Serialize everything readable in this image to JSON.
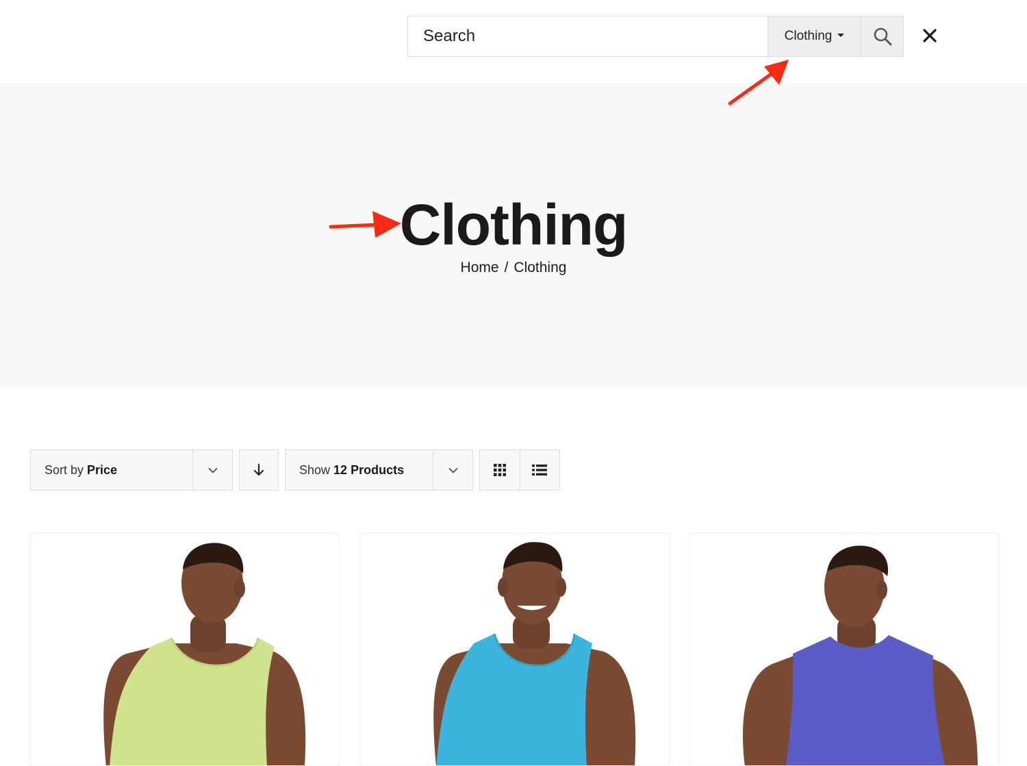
{
  "search": {
    "placeholder": "Search",
    "category": "Clothing"
  },
  "hero": {
    "title": "Clothing",
    "breadcrumb": [
      "Home",
      "/",
      "Clothing"
    ]
  },
  "toolbar": {
    "sort_prefix": "Sort by",
    "sort_value": "Price",
    "show_prefix": "Show",
    "show_value": "12 Products"
  },
  "icons": {
    "search": "search-icon",
    "close": "close-icon",
    "chevron": "chevron-down-icon",
    "sort_direction": "arrow-down-icon",
    "grid_view": "grid-icon",
    "list_view": "list-icon"
  },
  "products": [
    {
      "shirt_color": "#cfe38c",
      "style": "tank-top"
    },
    {
      "shirt_color": "#3db4dd",
      "style": "tank-top"
    },
    {
      "shirt_color": "#5a5dc8",
      "style": "sleeveless-tee"
    }
  ],
  "colors": {
    "hero_bg": "#f8f8f8",
    "annotation_arrow": "#ff2a12",
    "skin": "#7a4a33"
  }
}
